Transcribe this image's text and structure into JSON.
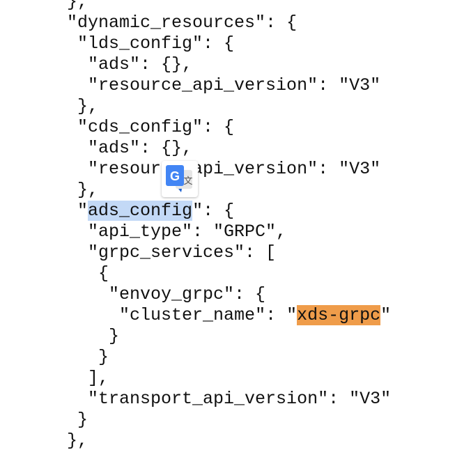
{
  "code": {
    "lines": [
      {
        "indent": "  ",
        "pre": "},",
        "mark": "",
        "post": ""
      },
      {
        "indent": "  ",
        "pre": "\"dynamic_resources\": {",
        "mark": "",
        "post": ""
      },
      {
        "indent": "   ",
        "pre": "\"lds_config\": {",
        "mark": "",
        "post": ""
      },
      {
        "indent": "    ",
        "pre": "\"ads\": {},",
        "mark": "",
        "post": ""
      },
      {
        "indent": "    ",
        "pre": "\"resource_api_version\": \"V3\"",
        "mark": "",
        "post": ""
      },
      {
        "indent": "   ",
        "pre": "},",
        "mark": "",
        "post": ""
      },
      {
        "indent": "   ",
        "pre": "\"cds_config\": {",
        "mark": "",
        "post": ""
      },
      {
        "indent": "    ",
        "pre": "\"ads\": {},",
        "mark": "",
        "post": ""
      },
      {
        "indent": "    ",
        "pre": "\"resource_api_version\": \"V3\"",
        "mark": "",
        "post": ""
      },
      {
        "indent": "   ",
        "pre": "},",
        "mark": "",
        "post": ""
      },
      {
        "indent": "   ",
        "pre": "\"",
        "mark": "ads_config",
        "post": "\": {"
      },
      {
        "indent": "    ",
        "pre": "\"api_type\": \"GRPC\",",
        "mark": "",
        "post": ""
      },
      {
        "indent": "    ",
        "pre": "\"grpc_services\": [",
        "mark": "",
        "post": ""
      },
      {
        "indent": "     ",
        "pre": "{",
        "mark": "",
        "post": ""
      },
      {
        "indent": "      ",
        "pre": "\"envoy_grpc\": {",
        "mark": "",
        "post": ""
      },
      {
        "indent": "       ",
        "pre": "\"cluster_name\": \"",
        "mark": "xds-grpc",
        "post": "\""
      },
      {
        "indent": "      ",
        "pre": "}",
        "mark": "",
        "post": ""
      },
      {
        "indent": "     ",
        "pre": "}",
        "mark": "",
        "post": ""
      },
      {
        "indent": "    ",
        "pre": "],",
        "mark": "",
        "post": ""
      },
      {
        "indent": "    ",
        "pre": "\"transport_api_version\": \"V3\"",
        "mark": "",
        "post": ""
      },
      {
        "indent": "   ",
        "pre": "}",
        "mark": "",
        "post": ""
      },
      {
        "indent": "  ",
        "pre": "},",
        "mark": "",
        "post": ""
      }
    ]
  },
  "highlights": {
    "selection_color": "#c3d9f6",
    "find_match_color": "#ef9c4a"
  },
  "overlay": {
    "icon": "google-translate-icon",
    "glyph_g": "G",
    "glyph_wen": "文",
    "colors": {
      "blue": "#4285f4",
      "gray": "#e6e6e6",
      "dark": "#555555"
    }
  }
}
